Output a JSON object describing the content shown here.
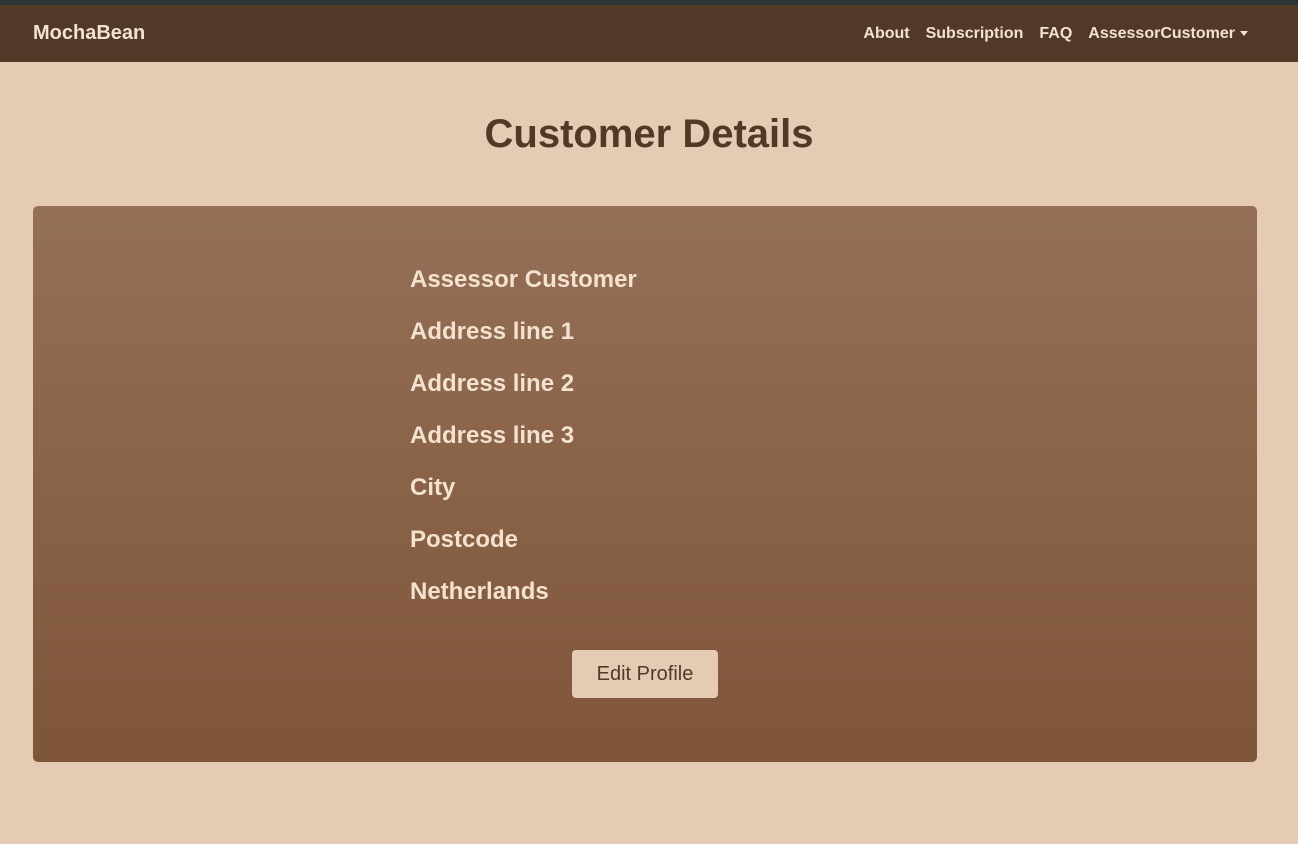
{
  "navbar": {
    "brand": "MochaBean",
    "links": [
      "About",
      "Subscription",
      "FAQ"
    ],
    "user_menu": "AssessorCustomer"
  },
  "page": {
    "title": "Customer Details"
  },
  "customer": {
    "name": "Assessor Customer",
    "address_line_1": "Address line 1",
    "address_line_2": "Address line 2",
    "address_line_3": "Address line 3",
    "city": "City",
    "postcode": "Postcode",
    "country": "Netherlands"
  },
  "actions": {
    "edit_profile_label": "Edit Profile"
  },
  "colors": {
    "navbar_bg": "#523827",
    "page_bg": "#e5cbb3",
    "card_top": "#946f57",
    "card_bottom": "#7f5539",
    "text_light": "#f3e2cf"
  }
}
